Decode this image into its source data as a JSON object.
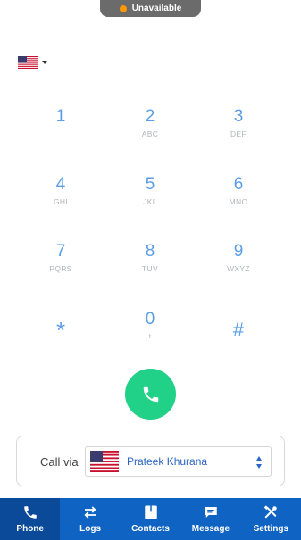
{
  "status": {
    "text": "Unavailable",
    "dot_color": "#ff9800"
  },
  "country": {
    "flag": "us-flag-icon"
  },
  "keypad": [
    {
      "digit": "1",
      "letters": ""
    },
    {
      "digit": "2",
      "letters": "ABC"
    },
    {
      "digit": "3",
      "letters": "DEF"
    },
    {
      "digit": "4",
      "letters": "GHI"
    },
    {
      "digit": "5",
      "letters": "JKL"
    },
    {
      "digit": "6",
      "letters": "MNO"
    },
    {
      "digit": "7",
      "letters": "PQRS"
    },
    {
      "digit": "8",
      "letters": "TUV"
    },
    {
      "digit": "9",
      "letters": "WXYZ"
    },
    {
      "digit": "*",
      "letters": ""
    },
    {
      "digit": "0",
      "letters": "+"
    },
    {
      "digit": "#",
      "letters": ""
    }
  ],
  "call_button": {
    "icon": "phone-icon",
    "color": "#21d188"
  },
  "call_via": {
    "label": "Call via",
    "selected": "Prateek Khurana"
  },
  "nav": {
    "active_color": "#0a4a99",
    "bar_color": "#0f63c3",
    "items": [
      {
        "label": "Phone",
        "icon": "phone-icon",
        "active": true
      },
      {
        "label": "Logs",
        "icon": "transfer-arrows-icon",
        "active": false
      },
      {
        "label": "Contacts",
        "icon": "address-book-icon",
        "active": false
      },
      {
        "label": "Message",
        "icon": "chat-bubble-icon",
        "active": false
      },
      {
        "label": "Settings",
        "icon": "tools-icon",
        "active": false
      }
    ]
  }
}
